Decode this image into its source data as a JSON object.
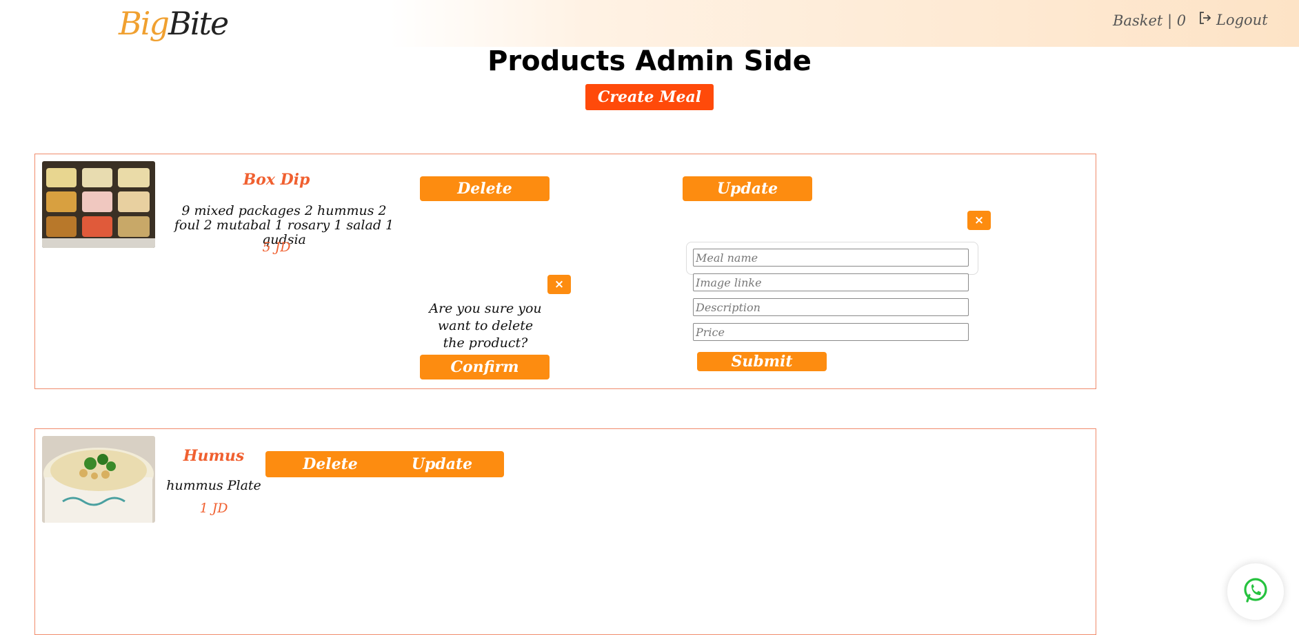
{
  "header": {
    "logo_big": "Big",
    "logo_bite": "Bite",
    "basket_label": "Basket | 0",
    "logout_label": "Logout"
  },
  "page": {
    "title": "Products Admin Side",
    "create_label": "Create Meal"
  },
  "products": [
    {
      "name": "Box Dip",
      "description": "9 mixed packages 2 hummus 2 foul 2 mutabal 1 rosary 1 salad 1 qudsia",
      "price": "5 JD",
      "delete_label": "Delete",
      "update_label": "Update"
    },
    {
      "name": "Humus",
      "description": "hummus Plate",
      "price": "1 JD",
      "delete_label": "Delete",
      "update_label": "Update"
    }
  ],
  "delete_dialog": {
    "close_label": "×",
    "question": "Are you sure you want to delete the product?",
    "confirm_label": "Confirm"
  },
  "update_form": {
    "close_label": "×",
    "meal_name_placeholder": "Meal name",
    "image_placeholder": "Image linke",
    "description_placeholder": "Description",
    "price_placeholder": "Price",
    "submit_label": "Submit"
  },
  "icons": {
    "logout": "logout-icon",
    "whatsapp": "whatsapp-icon"
  },
  "colors": {
    "accent_orange": "#fd8c10",
    "create_red": "#ff4a0a",
    "title_orange": "#f06030",
    "card_border": "#f08a6a"
  }
}
